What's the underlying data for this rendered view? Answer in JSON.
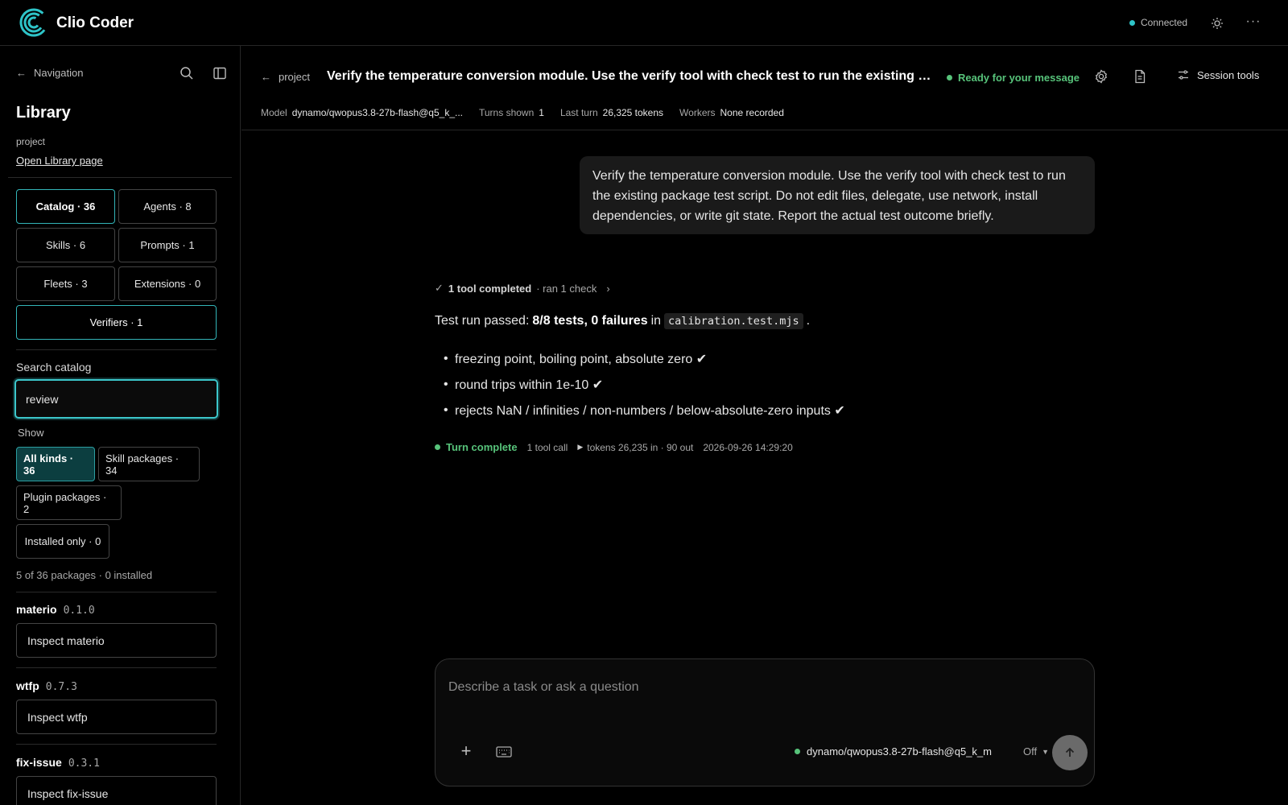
{
  "app": {
    "title": "Clio Coder",
    "status": "Connected",
    "status_color": "#2ec4c8"
  },
  "sidebar": {
    "nav_label": "Navigation",
    "library_title": "Library",
    "project": "project",
    "open_library": "Open Library page",
    "tabs": [
      {
        "label": "Catalog · 36",
        "active": true
      },
      {
        "label": "Agents · 8"
      },
      {
        "label": "Skills · 6"
      },
      {
        "label": "Prompts · 1"
      },
      {
        "label": "Fleets · 3"
      },
      {
        "label": "Extensions · 0"
      },
      {
        "label": "Verifiers · 1"
      }
    ],
    "search_label": "Search catalog",
    "search_value": "review",
    "show_label": "Show",
    "filters": [
      {
        "label": "All kinds · 36",
        "active": true
      },
      {
        "label": "Skill packages · 34"
      },
      {
        "label": "Plugin packages · 2"
      },
      {
        "label": "Installed only · 0"
      }
    ],
    "package_count": "5 of 36 packages · 0 installed",
    "packages": [
      {
        "name": "materio",
        "version": "0.1.0",
        "action": "Inspect materio"
      },
      {
        "name": "wtfp",
        "version": "0.7.3",
        "action": "Inspect wtfp"
      },
      {
        "name": "fix-issue",
        "version": "0.3.1",
        "action": "Inspect fix-issue"
      }
    ]
  },
  "header": {
    "breadcrumb": "project",
    "title": "Verify the temperature conversion module. Use the verify tool with check test to run the existing package test script. Do not edit files, delegate, use network, install dependencies, or write git state. Report the actual test outcome briefly.",
    "status": "Ready for your message",
    "status_color": "#57c37a",
    "session_tools": "Session tools",
    "meta": [
      {
        "key": "Model",
        "value": "dynamo/qwopus3.8-27b-flash@q5_k_..."
      },
      {
        "key": "Turns shown",
        "value": "1"
      },
      {
        "key": "Last turn",
        "value": "26,325 tokens"
      },
      {
        "key": "Workers",
        "value": "None recorded"
      }
    ]
  },
  "chat": {
    "user_message": "Verify the temperature conversion module. Use the verify tool with check test to run the existing package test script. Do not edit files, delegate, use network, install dependencies, or write git state. Report the actual test outcome briefly.",
    "tool_summary": {
      "check": "✓",
      "label": "1 tool completed",
      "detail": "· ran 1 check",
      "chevron": "›"
    },
    "answer": {
      "prefix": "Test run passed:",
      "bold": "8/8 tests, 0 failures",
      "mid": "in",
      "file": "calibration.test.mjs",
      "suffix": "."
    },
    "bullets": [
      "freezing point, boiling point, absolute zero ✔",
      "round trips within 1e-10 ✔",
      "rejects NaN / infinities / non-numbers / below-absolute-zero inputs ✔"
    ],
    "turn": {
      "status": "Turn complete",
      "calls": "1 tool call",
      "tokens": "tokens 26,235 in · 90 out",
      "timestamp": "2026-09-26 14:29:20"
    }
  },
  "composer": {
    "placeholder": "Describe a task or ask a question",
    "model": "dynamo/qwopus3.8-27b-flash@q5_k_m",
    "mode": "Off"
  }
}
